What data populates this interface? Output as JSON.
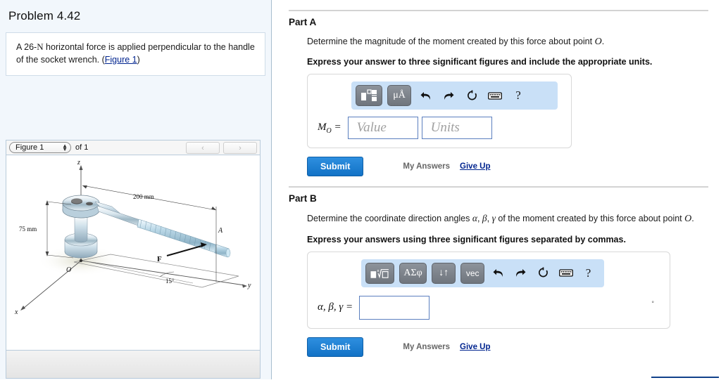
{
  "left": {
    "problem_title": "Problem 4.42",
    "statement_pre": "A 26-",
    "statement_n": "N",
    "statement_post": " horizontal force is applied perpendicular to the handle of the socket wrench. (",
    "figure_link": "Figure 1",
    "statement_close": ")",
    "figure_widget": {
      "selected": "Figure 1",
      "of_label": "of 1",
      "prev_glyph": "‹",
      "next_glyph": "›",
      "spin_up": "▲",
      "spin_down": "▼"
    },
    "figure": {
      "axis_z": "z",
      "axis_y": "y",
      "axis_x": "x",
      "point_o": "O",
      "point_a": "A",
      "force_label": "F",
      "dim_200": "200 mm",
      "dim_75": "75 mm",
      "angle_15": "15°"
    }
  },
  "partA": {
    "heading": "Part A",
    "question_pre": "Determine the magnitude of the moment created by this force about point ",
    "question_sym": "O",
    "question_post": ".",
    "instruction": "Express your answer to three significant figures and include the appropriate units.",
    "toolbar": {
      "template_label": "■",
      "units_label": "μÅ",
      "undo": "↶",
      "redo": "↷",
      "reset": "↺",
      "keyboard": "⌨",
      "help": "?"
    },
    "eq_label_base": "M",
    "eq_label_sub": "O",
    "eq_equals": " =",
    "value_placeholder": "Value",
    "units_placeholder": "Units",
    "submit_label": "Submit",
    "my_answers_label": "My Answers",
    "give_up_label": "Give Up"
  },
  "partB": {
    "heading": "Part B",
    "question_pre": "Determine the coordinate direction angles ",
    "question_alpha": "α",
    "question_sep1": ", ",
    "question_beta": "β",
    "question_sep2": ", ",
    "question_gamma": "γ",
    "question_post": " of the moment created by this force about point ",
    "question_sym": "O",
    "question_end": ".",
    "instruction": "Express your answers using three significant figures separated by commas.",
    "toolbar": {
      "template_label": "■",
      "root_label": "√",
      "greek_label": "ΑΣφ",
      "arrows_label": "↓↑",
      "vec_label": "vec",
      "undo": "↶",
      "redo": "↷",
      "reset": "↺",
      "keyboard": "⌨",
      "help": "?"
    },
    "eq_label": "α, β, γ =",
    "input_value": "",
    "degree_mark": "°",
    "submit_label": "Submit",
    "my_answers_label": "My Answers",
    "give_up_label": "Give Up"
  },
  "colors": {
    "accent_blue": "#1272c6",
    "link_blue": "#00248f",
    "toolbar_blue": "#c9e0f7",
    "panel_bg": "#f2f7fc"
  }
}
